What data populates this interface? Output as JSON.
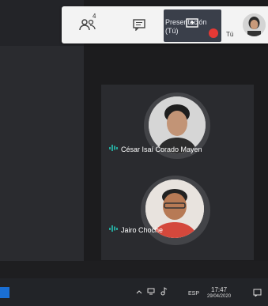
{
  "topbar": {
    "participants_count": "4",
    "presentation_label": "Presentación (Tú)",
    "self_label": "Tú"
  },
  "participants": [
    {
      "name": "César Isaí Corado Mayen"
    },
    {
      "name": "Jairo Choche"
    }
  ],
  "taskbar": {
    "language": "ESP",
    "time": "17:47",
    "date": "29/04/2020"
  },
  "colors": {
    "background": "#1c1c1e",
    "tile": "#2a2b2f",
    "topbar": "#f3f3f3",
    "audio_indicator": "#26a69a",
    "mute": "#e53935"
  },
  "icons": [
    "participants-icon",
    "chat-icon",
    "present-screen-icon",
    "mic-muted-icon",
    "audio-level-icon",
    "windows-start-icon",
    "chevron-up-icon",
    "network-icon",
    "volume-icon",
    "notification-icon"
  ]
}
